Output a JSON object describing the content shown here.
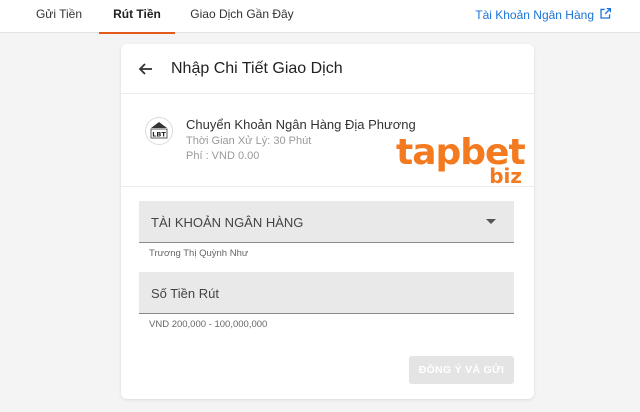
{
  "nav": {
    "tabs": [
      {
        "label": "Gửi Tiền"
      },
      {
        "label": "Rút Tiền"
      },
      {
        "label": "Giao Dịch Gần Đây"
      }
    ],
    "active_tab": "Rút Tiền",
    "bank_account_link": "Tài Khoản Ngân Hàng",
    "link_icon": "external-link-icon",
    "accent_color": "#e35a1b",
    "link_color": "#1a73d8"
  },
  "card": {
    "title": "Nhập Chi Tiết Giao Dịch",
    "back_icon": "arrow-left-icon",
    "method": {
      "logo_text": "LBT",
      "name": "Chuyển Khoản Ngân Hàng Địa Phương",
      "processing_time": "Thời Gian Xử Lý: 30 Phút",
      "fee": "Phí : VND 0.00"
    },
    "watermark": {
      "main": "tapbet",
      "sub": "biz",
      "color": "#f37a1f"
    },
    "bank_select": {
      "label": "TÀI KHOẢN NGÂN HÀNG",
      "helper": "Trương Thị Quỳnh Như"
    },
    "amount_input": {
      "label": "Số Tiền Rút",
      "helper": "VND 200,000 - 100,000,000"
    },
    "submit_label": "ĐỒNG Ý VÀ GỬI"
  }
}
